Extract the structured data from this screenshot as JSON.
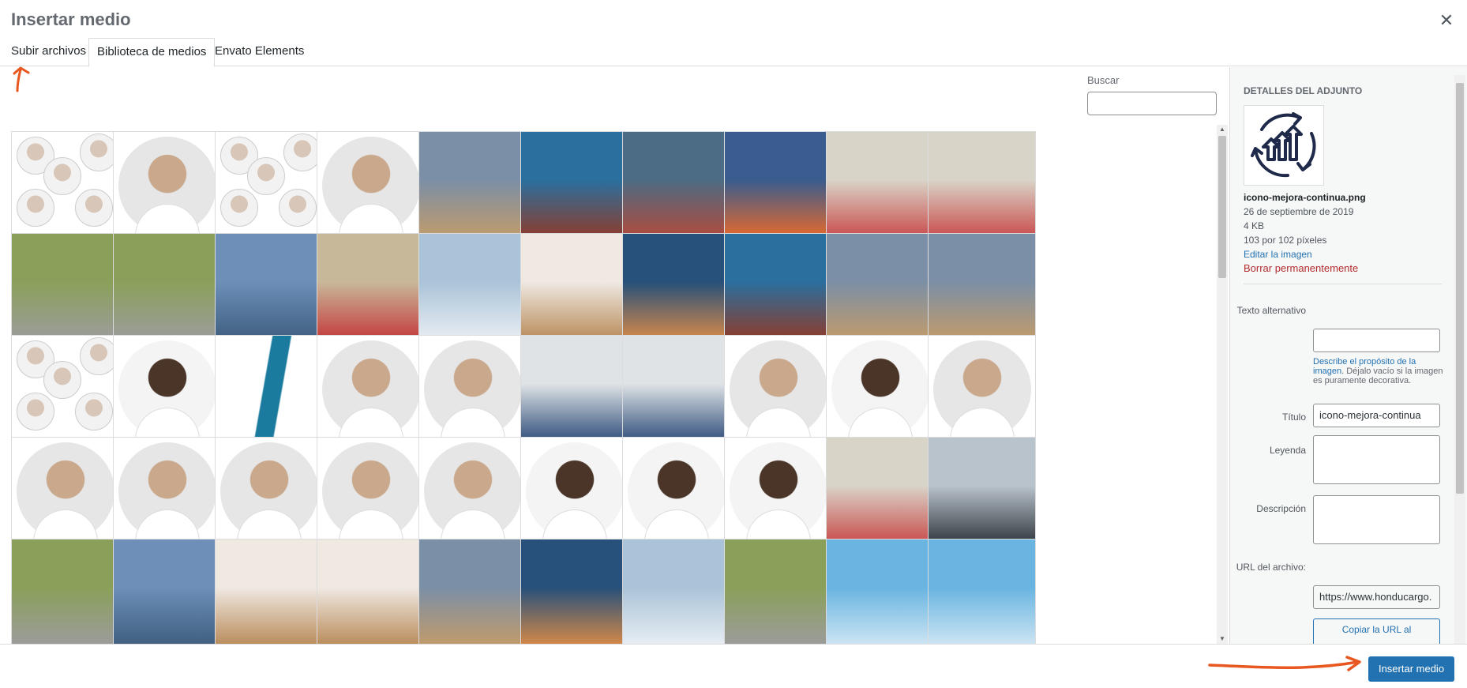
{
  "modal": {
    "title": "Insertar medio",
    "close_icon": "close-icon"
  },
  "tabs": [
    {
      "label": "Subir archivos",
      "active": false
    },
    {
      "label": "Biblioteca de medios",
      "active": true
    },
    {
      "label": "Envato Elements",
      "active": false
    }
  ],
  "search": {
    "label": "Buscar",
    "value": ""
  },
  "attachment": {
    "heading": "DETALLES DEL ADJUNTO",
    "filename": "icono-mejora-continua.png",
    "date": "26 de septiembre de 2019",
    "size": "4 KB",
    "dimensions": "103 por 102 píxeles",
    "edit_link": "Editar la imagen",
    "delete_link": "Borrar permanentemente",
    "alt_label": "Texto alternativo",
    "alt_value": "",
    "alt_help_link": "Describe el propósito de la imagen",
    "alt_help_rest": ". Déjalo vacío si la imagen es puramente decorativa.",
    "title_label": "Título",
    "title_value": "icono-mejora-continua",
    "caption_label": "Leyenda",
    "description_label": "Descripción",
    "url_label": "URL del archivo:",
    "url_value": "https://www.honducargo.",
    "copy_button": "Copiar la URL al"
  },
  "toolbar": {
    "insert_button": "Insertar medio"
  },
  "colors": {
    "primary": "#2271b1",
    "danger": "#b32d2e",
    "annotation": "#e8571f"
  }
}
